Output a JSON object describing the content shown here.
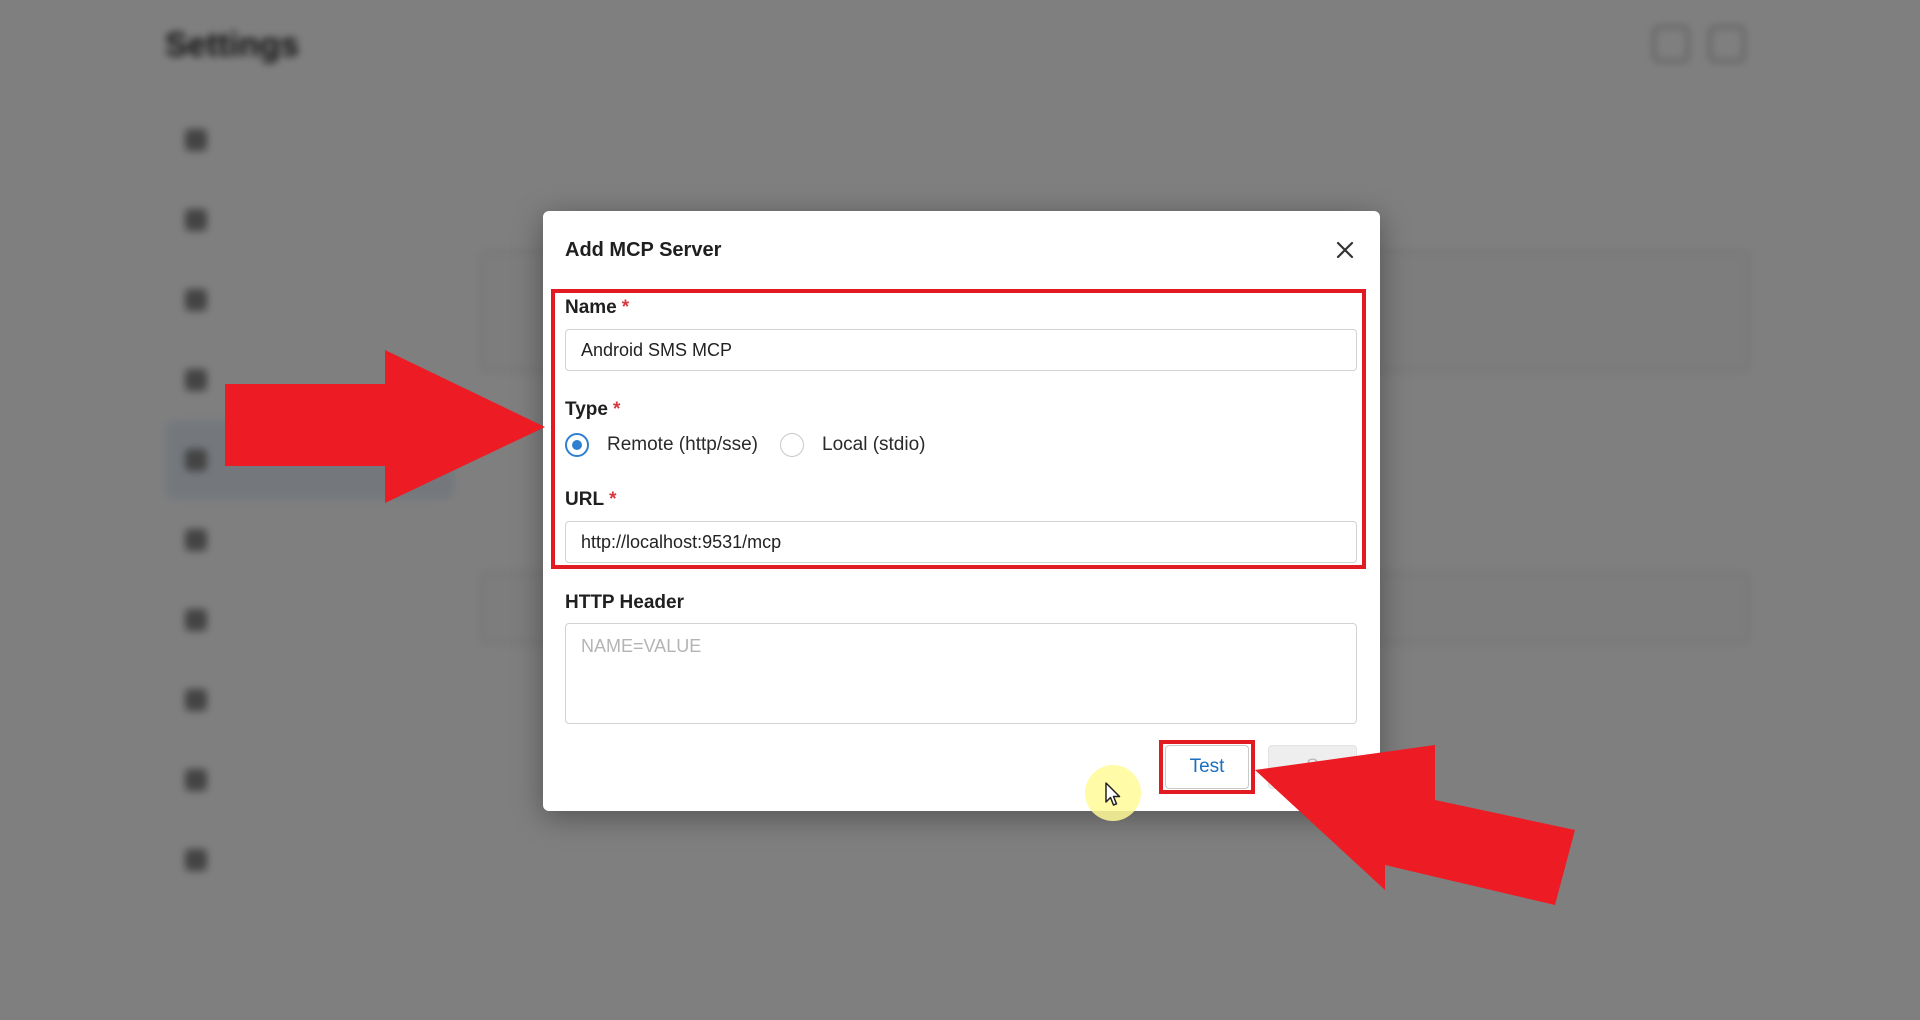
{
  "background": {
    "title": "Settings"
  },
  "dialog": {
    "title": "Add MCP Server",
    "name_label": "Name",
    "name_value": "Android SMS MCP",
    "type_label": "Type",
    "type_options": [
      {
        "label": "Remote (http/sse)",
        "selected": true
      },
      {
        "label": "Local (stdio)",
        "selected": false
      }
    ],
    "url_label": "URL",
    "url_value": "http://localhost:9531/mcp",
    "header_label": "HTTP Header",
    "header_placeholder": "NAME=VALUE",
    "required_mark": "*",
    "test_button": "Test",
    "save_button": "S"
  },
  "colors": {
    "accent": "#2f7fd0",
    "required": "#d9363e",
    "annotation": "#e21b23"
  },
  "icons": {
    "close": "close-icon",
    "cursor": "mouse-pointer-icon"
  }
}
